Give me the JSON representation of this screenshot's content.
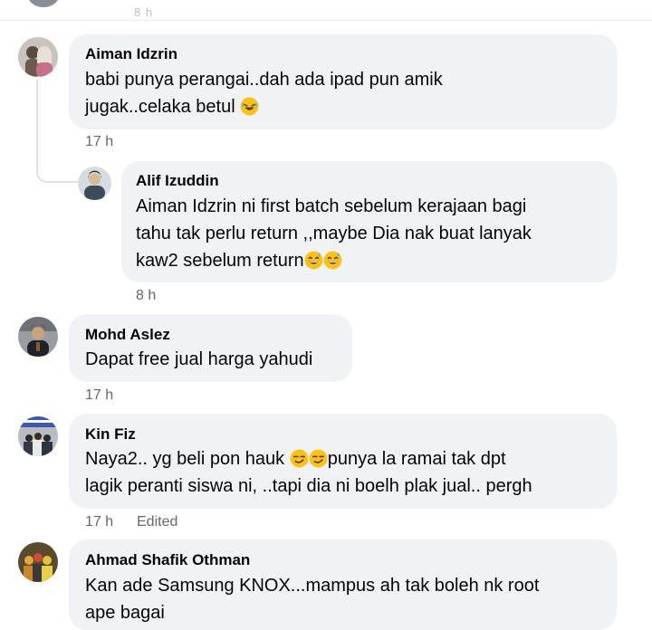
{
  "top_partial": {
    "meta": "8 h"
  },
  "comments": [
    {
      "author": "Aiman Idzrin",
      "lines": [
        "babi punya perangai..dah ada ipad pun amik",
        "jugak..celaka betul"
      ],
      "time": "17 h",
      "emojis": [
        "rofl-emoji"
      ]
    },
    {
      "author": "Alif Izuddin",
      "lines": [
        "Aiman Idzrin ni first batch sebelum kerajaan bagi",
        "tahu tak perlu return ,,maybe Dia nak buat lanyak",
        "kaw2 sebelum return"
      ],
      "time": "8 h",
      "emojis": [
        "sweat-smile-emoji",
        "sweat-smile-emoji"
      ]
    },
    {
      "author": "Mohd Aslez",
      "lines": [
        "Dapat free jual harga yahudi"
      ],
      "time": "17 h"
    },
    {
      "author": "Kin Fiz",
      "lines": [
        "Naya2.. yg beli pon hauk",
        "punya la ramai tak dpt",
        "lagik peranti siswa ni, ..tapi dia ni boelh plak jual.. pergh"
      ],
      "time": "17 h",
      "edited": "Edited",
      "emojis": [
        "smirk-emoji",
        "smirk-emoji"
      ]
    },
    {
      "author": "Ahmad Shafik Othman",
      "lines": [
        "Kan ade Samsung KNOX...mampus ah tak boleh nk root",
        "ape bagai"
      ]
    }
  ],
  "colors": {
    "bubble": "#f0f2f5",
    "meta": "#65676b",
    "text": "#050505",
    "thread": "#dfe1e5"
  }
}
